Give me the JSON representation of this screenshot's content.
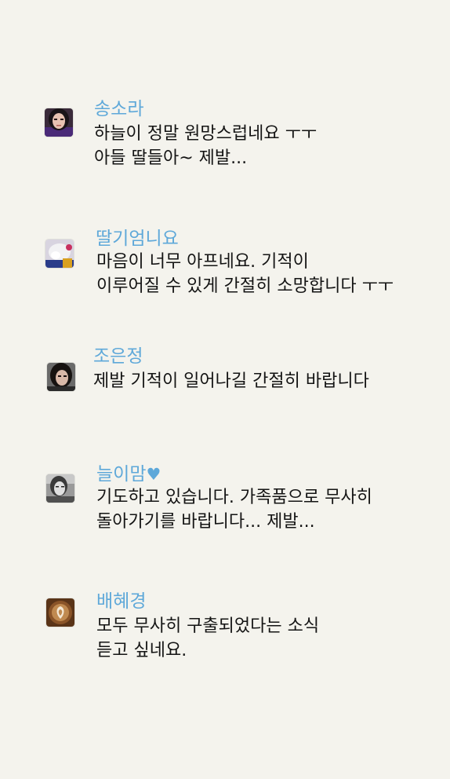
{
  "comments": [
    {
      "author": "송소라",
      "lines": [
        "하늘이 정말 원망스럽네요 ㅜㅜ",
        "아들 딸들아~ 제발..."
      ],
      "avatar": "avatar-woman-dark-hair"
    },
    {
      "author": "딸기엄니요",
      "lines": [
        "마음이 너무 아프네요. 기적이",
        "이루어질 수 있게 간절히 소망합니다 ㅜㅜ"
      ],
      "avatar": "avatar-white-hood"
    },
    {
      "author": "조은정",
      "lines": [
        "제발 기적이 일어나길 간절히 바랍니다"
      ],
      "avatar": "avatar-woman-portrait"
    },
    {
      "author": "늘이맘",
      "author_suffix": "♥",
      "lines": [
        "기도하고 있습니다. 가족품으로 무사히",
        "돌아가기를 바랍니다... 제발..."
      ],
      "avatar": "avatar-woman-bw"
    },
    {
      "author": "배혜경",
      "lines": [
        "모두 무사히 구출되었다는 소식",
        "듣고 싶네요."
      ],
      "avatar": "avatar-latte-art"
    }
  ],
  "colors": {
    "background": "#f4f3ed",
    "author": "#5ea8d9",
    "text": "#141414"
  }
}
